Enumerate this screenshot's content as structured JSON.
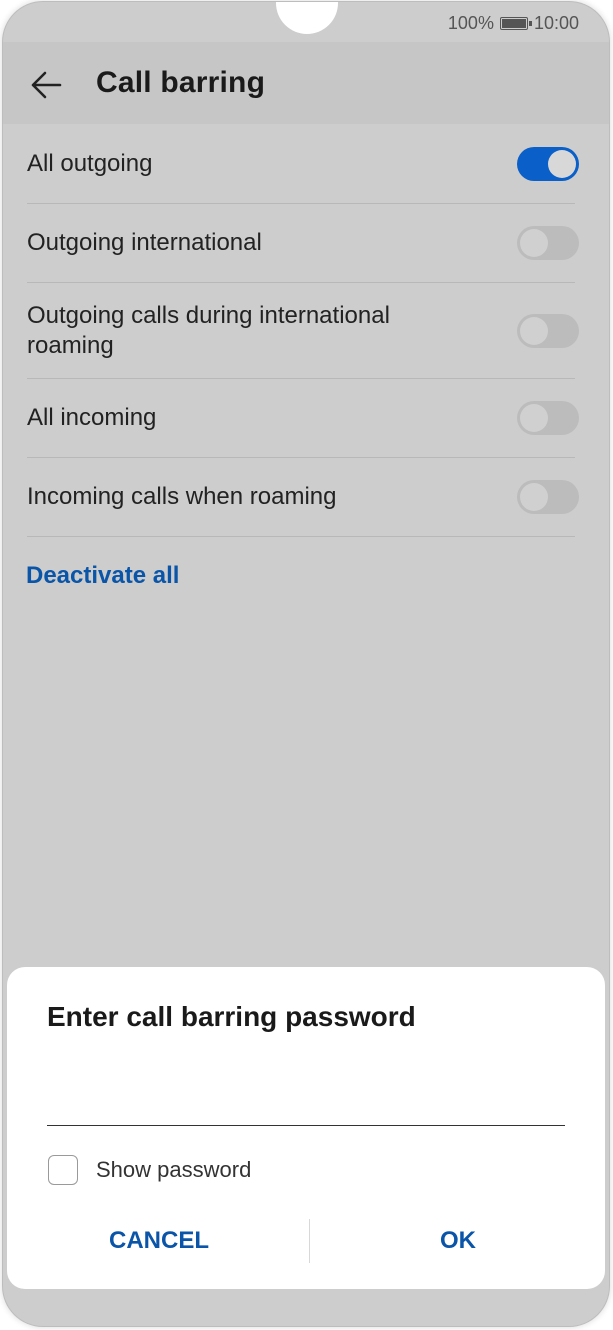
{
  "status": {
    "battery": "100%",
    "time": "10:00"
  },
  "appbar": {
    "back_icon": "back-arrow-icon",
    "title": "Call barring"
  },
  "rows": [
    {
      "label": "All outgoing",
      "on": true
    },
    {
      "label": "Outgoing international",
      "on": false
    },
    {
      "label": "Outgoing calls during international roaming",
      "on": false
    },
    {
      "label": "All incoming",
      "on": false
    },
    {
      "label": "Incoming calls when roaming",
      "on": false
    }
  ],
  "deactivate_label": "Deactivate all",
  "dialog": {
    "title": "Enter call barring password",
    "password_value": "",
    "show_password_label": "Show password",
    "show_password_checked": false,
    "cancel_label": "CANCEL",
    "ok_label": "OK"
  },
  "colors": {
    "accent": "#0a5fc8",
    "link": "#0a55a8",
    "scrim_bg": "#cdcdcd"
  }
}
